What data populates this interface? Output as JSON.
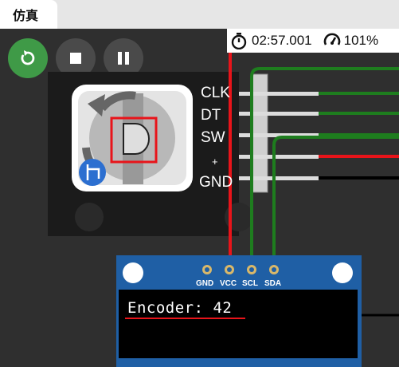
{
  "tabs": [
    {
      "label": "仿真"
    }
  ],
  "controls": {
    "restart": {
      "icon": "restart-icon"
    },
    "stop": {
      "icon": "stop-icon"
    },
    "pause": {
      "icon": "pause-icon"
    }
  },
  "status": {
    "elapsed_time": "02:57.001",
    "speed": "101%",
    "timer_icon": "stopwatch-icon",
    "speed_icon": "speedometer-icon"
  },
  "encoder": {
    "pins": [
      "CLK",
      "DT",
      "SW",
      "+",
      "GND"
    ]
  },
  "oled": {
    "pins": [
      "GND",
      "VCC",
      "SCL",
      "SDA"
    ],
    "display_text": "Encoder: 42"
  },
  "colors": {
    "accent_green": "#3f9a47",
    "wire_red": "#e8141a",
    "wire_green": "#1e7d1e",
    "wire_white": "#dcdcdc",
    "wire_black": "#000000",
    "oled_blue": "#1f5fa5",
    "highlight_red": "#e8141a"
  }
}
